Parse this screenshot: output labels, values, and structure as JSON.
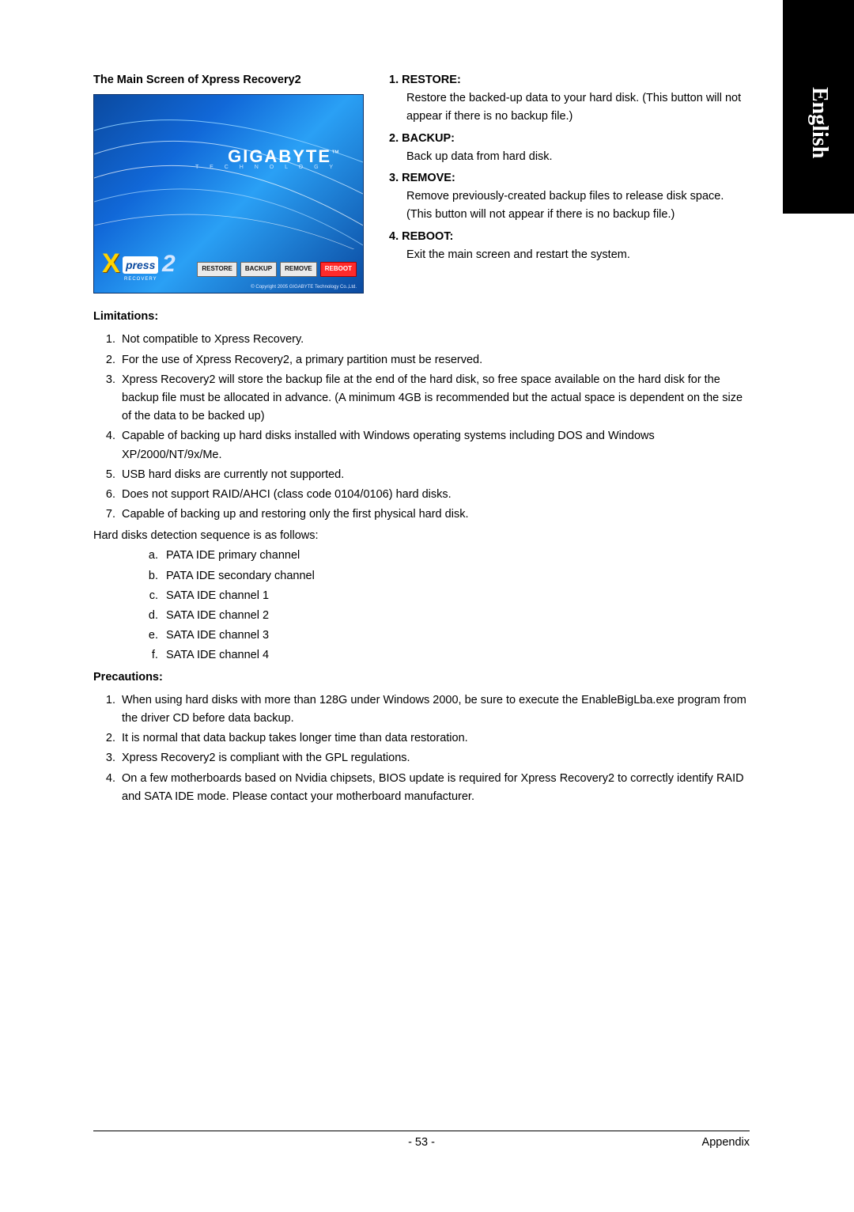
{
  "sideTab": "English",
  "header": {
    "mainTitle": "The Main Screen of Xpress Recovery2"
  },
  "screenshot": {
    "logo": "GIGABYTE",
    "logoSub": "T E C H N O L O G Y",
    "xpressX": "X",
    "xpressWord": "press",
    "xpressTwo": "2",
    "xpressRec": "RECOVERY",
    "buttons": {
      "restore": "RESTORE",
      "backup": "BACKUP",
      "remove": "REMOVE",
      "reboot": "REBOOT"
    },
    "copyright": "© Copyright 2005 GIGABYTE Technology Co.,Ltd."
  },
  "functions": {
    "restore": {
      "head": "1. RESTORE:",
      "body": "Restore the backed-up data to your hard disk. (This button will not appear if there is no backup file.)"
    },
    "backup": {
      "head": "2. BACKUP:",
      "body": "Back up data from hard disk."
    },
    "remove": {
      "head": "3. REMOVE:",
      "body": "Remove previously-created backup files to release disk space.",
      "body2": "(This button will not appear if there is no backup file.)"
    },
    "reboot": {
      "head": "4. REBOOT:",
      "body": "Exit the main screen and restart the system."
    }
  },
  "limitations": {
    "title": "Limitations:",
    "items": [
      "Not compatible to Xpress Recovery.",
      "For the use of Xpress Recovery2, a primary partition must be reserved.",
      "Xpress Recovery2 will store the backup file at the end of the hard disk, so free space available on the hard disk for the backup file must be allocated in advance. (A minimum 4GB is recommended but the actual space is dependent on the size of the data to be backed up)",
      "Capable of backing up hard disks installed with Windows operating systems including DOS and Windows XP/2000/NT/9x/Me.",
      "USB hard disks are currently not supported.",
      "Does not support RAID/AHCI (class code 0104/0106) hard disks.",
      "Capable of backing up and restoring only the first physical hard disk."
    ],
    "seqIntro": "Hard disks detection sequence is as follows:",
    "seq": [
      "PATA IDE primary channel",
      "PATA IDE secondary channel",
      "SATA IDE channel 1",
      "SATA IDE channel 2",
      "SATA IDE channel 3",
      "SATA IDE channel 4"
    ]
  },
  "precautions": {
    "title": "Precautions:",
    "items": [
      "When using hard disks with more than 128G under Windows 2000, be sure to execute the EnableBigLba.exe program from the driver CD before data backup.",
      "It is normal that data backup takes longer time than data restoration.",
      "Xpress Recovery2 is compliant with the GPL regulations.",
      "On a few motherboards based on Nvidia chipsets, BIOS update is required for Xpress Recovery2 to correctly identify RAID and SATA IDE mode. Please contact your motherboard manufacturer."
    ]
  },
  "footer": {
    "page": "- 53 -",
    "section": "Appendix"
  }
}
